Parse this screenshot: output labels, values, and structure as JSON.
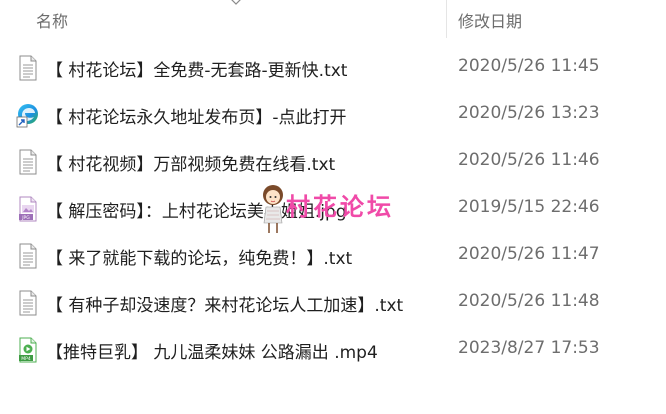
{
  "header": {
    "name_label": "名称",
    "date_label": "修改日期"
  },
  "files": [
    {
      "name": "【 村花论坛】全免费-无套路-更新快.txt",
      "modified": "2020/5/26 11:45",
      "icon": "text-file-icon"
    },
    {
      "name": "【 村花论坛永久地址发布页】-点此打开",
      "modified": "2020/5/26 13:23",
      "icon": "edge-shortcut-icon"
    },
    {
      "name": "【 村花视频】万部视频免费在线看.txt",
      "modified": "2020/5/26 11:46",
      "icon": "text-file-icon"
    },
    {
      "name": "【 解压密码】：上村花论坛美小姐姐.jpg",
      "modified": "2019/5/15 22:46",
      "icon": "jpg-file-icon"
    },
    {
      "name": "【 来了就能下载的论坛，纯免费！】.txt",
      "modified": "2020/5/26 11:47",
      "icon": "text-file-icon"
    },
    {
      "name": "【 有种子却没速度？来村花论坛人工加速】.txt",
      "modified": "2020/5/26 11:48",
      "icon": "text-file-icon"
    },
    {
      "name": "【推特巨乳】 九儿温柔妹妹 公路漏出 .mp4",
      "modified": "2023/8/27 17:53",
      "icon": "mp4-file-icon"
    }
  ],
  "watermark": {
    "text": "村花论坛",
    "color": "#f04aa8"
  },
  "colors": {
    "header_text": "#6d6d6d",
    "date_text": "#6d6d6d",
    "name_text": "#1f1f1f"
  }
}
